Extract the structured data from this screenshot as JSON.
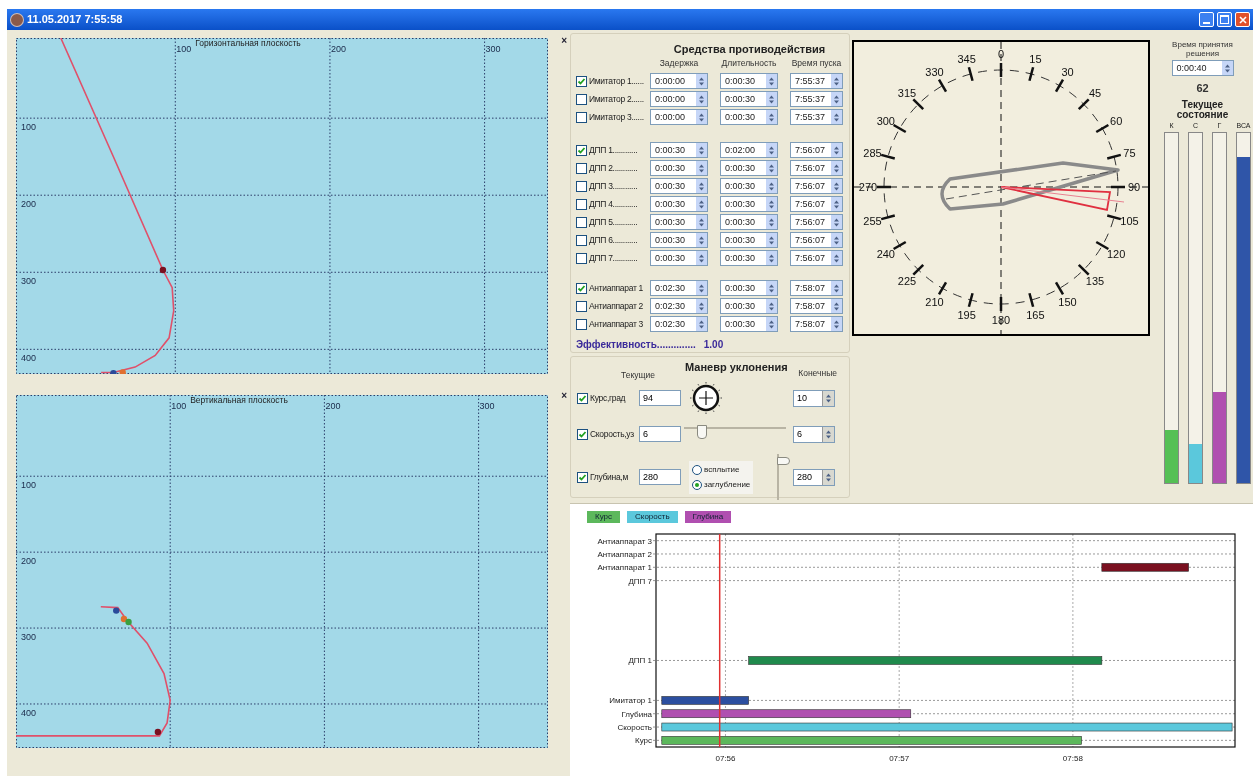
{
  "window": {
    "title": "11.05.2017 7:55:58"
  },
  "horizontal_plot": {
    "title": "Горизонтальная плоскость",
    "close": "×",
    "x_axis_labels": [
      "100",
      "200",
      "300"
    ],
    "y_axis_labels": [
      "100",
      "200",
      "300",
      "400"
    ]
  },
  "vertical_plot": {
    "title": "Вертикальная плоскость",
    "close": "×",
    "x_axis_labels": [
      "100",
      "200",
      "300"
    ],
    "y_axis_labels": [
      "100",
      "200",
      "300",
      "400"
    ]
  },
  "countermeasures": {
    "title": "Средства противодействия",
    "columns": [
      "Задержка",
      "Длительность",
      "Время пуска"
    ],
    "groups": [
      [
        {
          "label": "Имитатор 1......",
          "checked": true,
          "delay": "0:00:00",
          "duration": "0:00:30",
          "launch": "7:55:37"
        },
        {
          "label": "Имитатор 2......",
          "checked": false,
          "delay": "0:00:00",
          "duration": "0:00:30",
          "launch": "7:55:37"
        },
        {
          "label": "Имитатор 3......",
          "checked": false,
          "delay": "0:00:00",
          "duration": "0:00:30",
          "launch": "7:55:37"
        }
      ],
      [
        {
          "label": "ДПП 1............",
          "checked": true,
          "delay": "0:00:30",
          "duration": "0:02:00",
          "launch": "7:56:07"
        },
        {
          "label": "ДПП 2............",
          "checked": false,
          "delay": "0:00:30",
          "duration": "0:00:30",
          "launch": "7:56:07"
        },
        {
          "label": "ДПП 3............",
          "checked": false,
          "delay": "0:00:30",
          "duration": "0:00:30",
          "launch": "7:56:07"
        },
        {
          "label": "ДПП 4............",
          "checked": false,
          "delay": "0:00:30",
          "duration": "0:00:30",
          "launch": "7:56:07"
        },
        {
          "label": "ДПП 5............",
          "checked": false,
          "delay": "0:00:30",
          "duration": "0:00:30",
          "launch": "7:56:07"
        },
        {
          "label": "ДПП 6............",
          "checked": false,
          "delay": "0:00:30",
          "duration": "0:00:30",
          "launch": "7:56:07"
        },
        {
          "label": "ДПП 7............",
          "checked": false,
          "delay": "0:00:30",
          "duration": "0:00:30",
          "launch": "7:56:07"
        }
      ],
      [
        {
          "label": "Антиаппарат 1",
          "checked": true,
          "delay": "0:02:30",
          "duration": "0:00:30",
          "launch": "7:58:07"
        },
        {
          "label": "Антиаппарат 2",
          "checked": false,
          "delay": "0:02:30",
          "duration": "0:00:30",
          "launch": "7:58:07"
        },
        {
          "label": "Антиаппарат 3",
          "checked": false,
          "delay": "0:02:30",
          "duration": "0:00:30",
          "launch": "7:58:07"
        }
      ]
    ],
    "efficiency_label": "Эффективность..............",
    "efficiency_value": "1.00"
  },
  "maneuver": {
    "title": "Маневр уклонения",
    "current_header": "Текущие",
    "final_header": "Конечные",
    "rows": [
      {
        "kind": "dial",
        "label": "Курс,град",
        "checked": true,
        "current": "94",
        "final": "10"
      },
      {
        "kind": "slider",
        "label": "Скорость,уз",
        "checked": true,
        "current": "6",
        "level": 0.18,
        "final": "6"
      },
      {
        "kind": "radio",
        "label": "Глубина,м",
        "checked": true,
        "current": "280",
        "options": [
          {
            "label": "всплытие",
            "selected": false
          },
          {
            "label": "заглубление",
            "selected": true
          }
        ],
        "level": 0.85,
        "final": "280"
      }
    ]
  },
  "compass": {
    "right_labels": [
      "0",
      "15",
      "30",
      "45",
      "60",
      "75",
      "90",
      "105",
      "120",
      "135",
      "150",
      "165",
      "180"
    ],
    "left_labels": [
      "345",
      "330",
      "315",
      "300",
      "285",
      "270",
      "255",
      "240",
      "225",
      "210",
      "195"
    ]
  },
  "status": {
    "decision_time_label": "Время принятия решения",
    "decision_time": "0:00:40",
    "counter": "62",
    "state_title": "Текущее состояние",
    "bars": [
      {
        "label": "К",
        "color": "#55c055",
        "level": 0.15
      },
      {
        "label": "С",
        "color": "#5bc8dc",
        "level": 0.11
      },
      {
        "label": "Г",
        "color": "#b050b0",
        "level": 0.26
      },
      {
        "label": "ВСА",
        "color": "#2f55a8",
        "level": 0.93
      }
    ]
  },
  "timeline": {
    "legend": [
      {
        "label": "Курс",
        "color": "#5cb85c"
      },
      {
        "label": "Скорость",
        "color": "#5bc8dc"
      },
      {
        "label": "Глубина",
        "color": "#b04fb0"
      }
    ],
    "row_labels": [
      "Антиаппарат 3",
      "Антиаппарат 2",
      "Антиаппарат 1",
      "ДПП 7",
      "ДПП 1",
      "Имитатор 1",
      "Глубина",
      "Скорость",
      "Курс"
    ],
    "time_labels": [
      "07:56",
      "07:57",
      "07:58"
    ]
  }
}
